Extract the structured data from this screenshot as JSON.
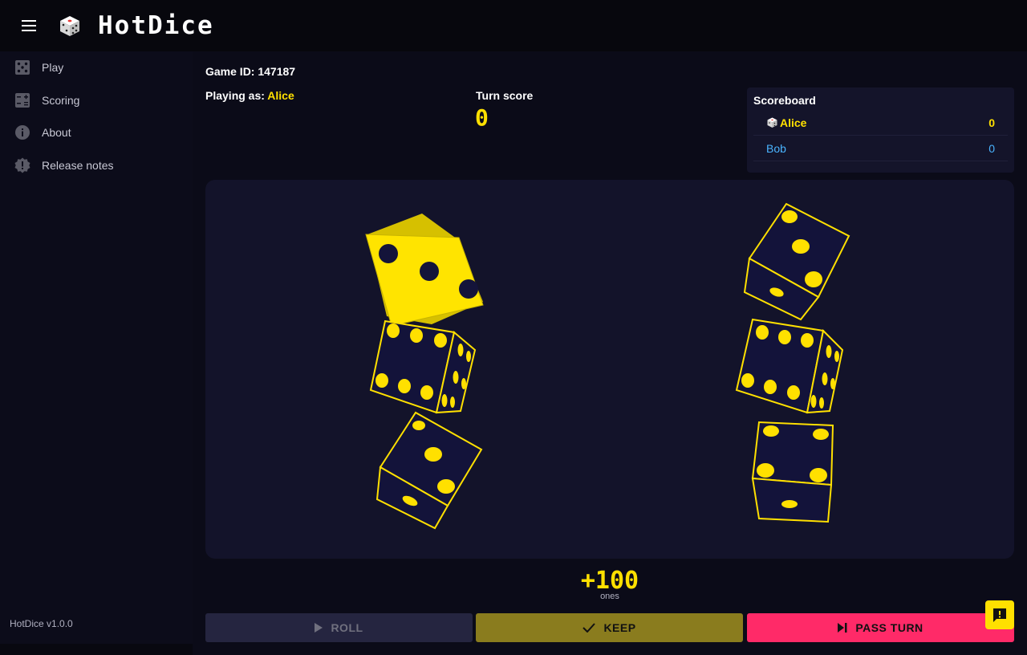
{
  "app": {
    "title": "HotDice",
    "version": "HotDice v1.0.0"
  },
  "sidebar": {
    "items": [
      {
        "label": "Play",
        "icon": "dice-five-icon"
      },
      {
        "label": "Scoring",
        "icon": "calculator-icon"
      },
      {
        "label": "About",
        "icon": "info-icon"
      },
      {
        "label": "Release notes",
        "icon": "release-badge-icon"
      }
    ]
  },
  "game": {
    "id_label": "Game ID: 147187",
    "playing_as_label": "Playing as:",
    "player_name": "Alice",
    "turn_score_label": "Turn score",
    "turn_score": "0"
  },
  "scoreboard": {
    "title": "Scoreboard",
    "players": [
      {
        "name": "Alice",
        "score": "0",
        "current": true
      },
      {
        "name": "Bob",
        "score": "0",
        "current": false
      }
    ]
  },
  "dice": [
    {
      "face": 3,
      "selected": true
    },
    {
      "face": 6,
      "selected": false
    },
    {
      "face": 3,
      "selected": false
    },
    {
      "face": 3,
      "selected": false
    },
    {
      "face": 6,
      "selected": false
    },
    {
      "face": 4,
      "selected": false
    }
  ],
  "selection": {
    "score": "+100",
    "description": "ones"
  },
  "actions": {
    "roll": "ROLL",
    "keep": "KEEP",
    "pass": "PASS TURN"
  },
  "colors": {
    "accent": "#ffe000",
    "pass": "#ff2a68",
    "player2": "#4ab4ff",
    "background": "#0b0b18"
  }
}
